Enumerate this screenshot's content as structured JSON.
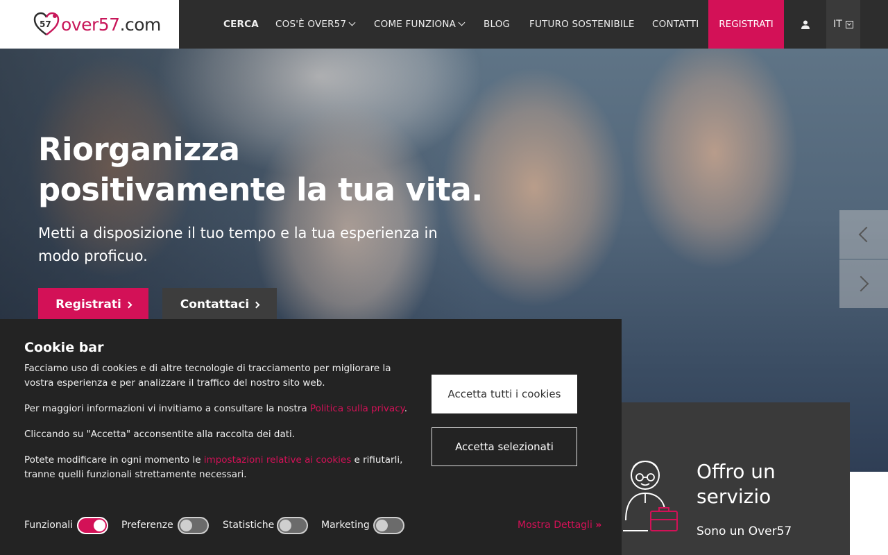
{
  "brand": {
    "logo_text_main": "over57",
    "logo_text_suffix": ".com",
    "logo_badge": "57",
    "accent_color": "#d31157"
  },
  "nav": {
    "items": [
      {
        "label": "CERCA"
      },
      {
        "label": "COS'È OVER57"
      },
      {
        "label": "COME FUNZIONA"
      },
      {
        "label": "BLOG"
      },
      {
        "label": "FUTURO SOSTENIBILE"
      },
      {
        "label": "CONTATTI"
      }
    ],
    "register_label": "REGISTRATI",
    "user_icon": "user-icon",
    "language": "IT"
  },
  "hero": {
    "title_line1": "Riorganizza",
    "title_line2": "positivamente la tua vita.",
    "subtitle": "Metti a disposizione il tuo tempo e la tua esperienza in modo proficuo.",
    "btn_register": "Registrati",
    "btn_contact": "Contattaci"
  },
  "service_card": {
    "title": "Offro un servizio",
    "subtitle": "Sono un Over57",
    "icon": "elderly-with-briefcase-icon"
  },
  "cookie_bar": {
    "title": "Cookie bar",
    "p1": "Facciamo uso di cookies e di altre tecnologie di tracciamento per migliorare la vostra esperienza e per analizzare il traffico del nostro sito web.",
    "p2_before": "Per maggiori informazioni vi invitiamo a consultare la nostra ",
    "p2_link": "Politica sulla privacy",
    "p2_after": ".",
    "p3": "Cliccando su \"Accetta\" acconsentite alla raccolta dei dati.",
    "p4_before": "Potete modificare in ogni momento le ",
    "p4_link": "impostazioni relative ai cookies",
    "p4_after": " e rifiutarli, tranne quelli funzionali strettamente necessari.",
    "btn_accept_all": "Accetta tutti i cookies",
    "btn_accept_selected": "Accetta selezionati",
    "toggles": [
      {
        "label": "Funzionali",
        "on": true
      },
      {
        "label": "Preferenze",
        "on": false
      },
      {
        "label": "Statistiche",
        "on": false
      },
      {
        "label": "Marketing",
        "on": false
      }
    ],
    "details_label": "Mostra Dettagli",
    "details_icon": "double-chevron-right-icon"
  }
}
